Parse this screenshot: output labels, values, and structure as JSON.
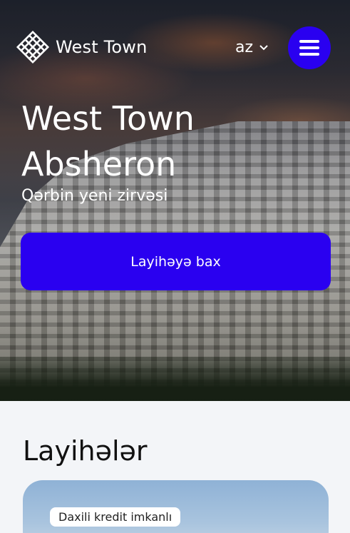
{
  "header": {
    "logo_text": "West Town",
    "lang_label": "az"
  },
  "hero": {
    "title_line1": "West Town",
    "title_line2": "Absheron",
    "subtitle": "Qərbin yeni zirvəsi",
    "cta_label": "Layihəyə bax"
  },
  "projects": {
    "section_title": "Layihələr",
    "card_badge": "Daxili kredit imkanlı"
  },
  "colors": {
    "accent": "#2a00f0",
    "background": "#f3f5f8"
  }
}
